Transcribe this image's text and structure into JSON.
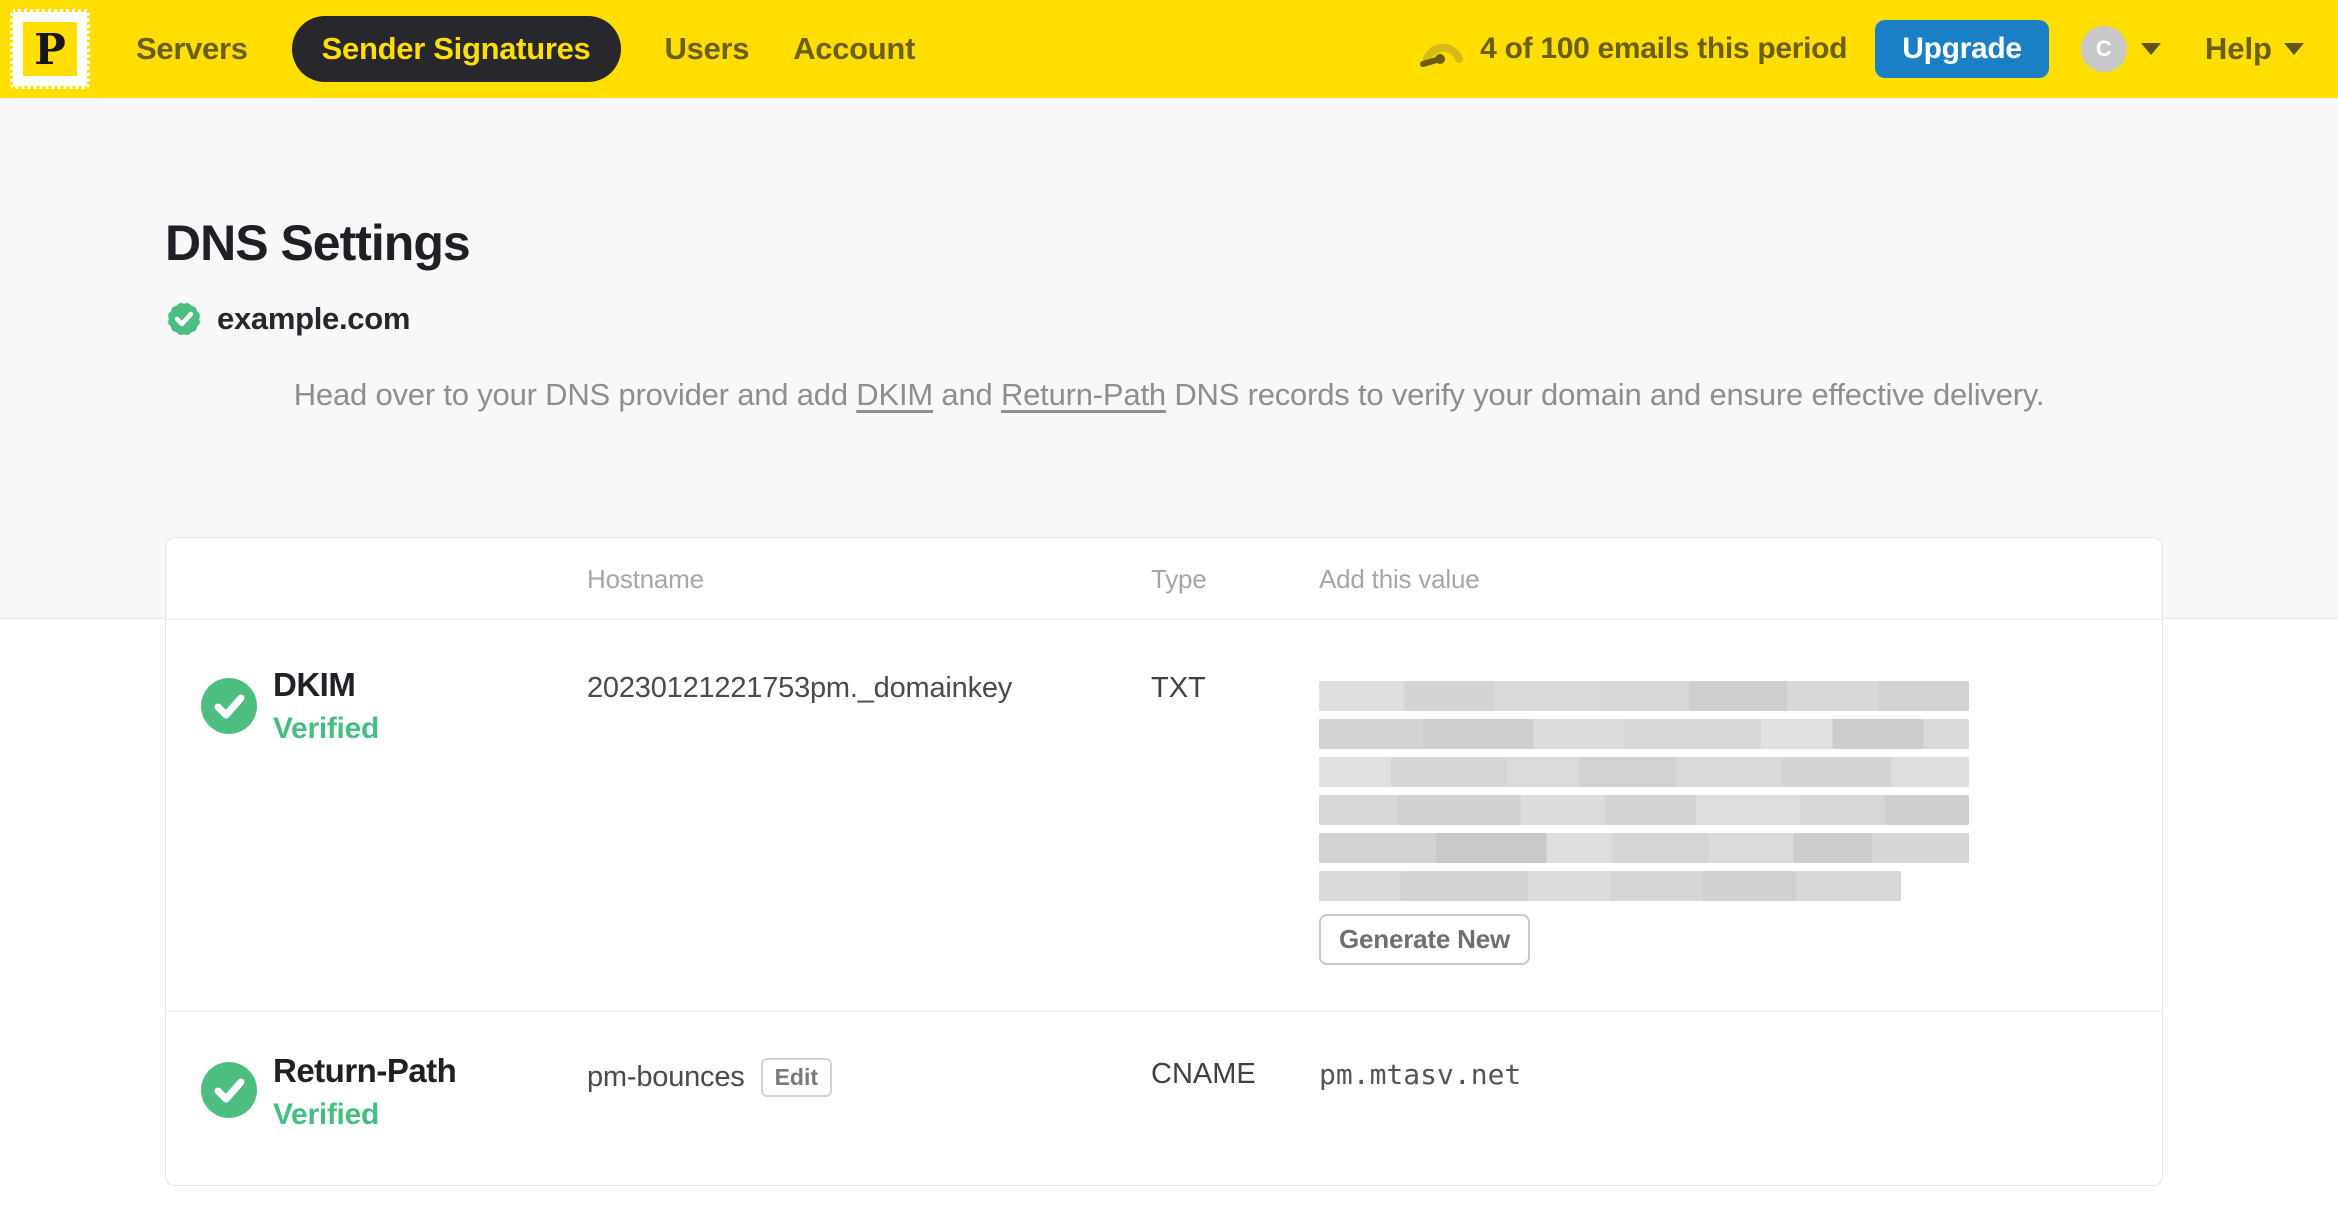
{
  "nav": {
    "logo_letter": "P",
    "items": [
      {
        "label": "Servers",
        "active": false
      },
      {
        "label": "Sender Signatures",
        "active": true
      },
      {
        "label": "Users",
        "active": false
      },
      {
        "label": "Account",
        "active": false
      }
    ],
    "usage_text": "4 of 100 emails this period",
    "upgrade_label": "Upgrade",
    "avatar_initial": "C",
    "help_label": "Help"
  },
  "page": {
    "title": "DNS Settings",
    "domain": "example.com",
    "description": {
      "part1": "Head over to your DNS provider and add ",
      "link_dkim": "DKIM",
      "part2": " and ",
      "link_return_path": "Return-Path",
      "part3": " DNS records to verify your domain and ensure effective delivery."
    }
  },
  "table": {
    "headers": {
      "hostname": "Hostname",
      "type": "Type",
      "value": "Add this value"
    },
    "rows": [
      {
        "name": "DKIM",
        "status": "Verified",
        "hostname": "20230121221753pm._domainkey",
        "type": "TXT",
        "value": "(redacted)",
        "action_label": "Generate New"
      },
      {
        "name": "Return-Path",
        "status": "Verified",
        "hostname": "pm-bounces",
        "edit_label": "Edit",
        "type": "CNAME",
        "value": "pm.mtasv.net"
      }
    ]
  },
  "colors": {
    "brand_yellow": "#FFDE00",
    "active_pill": "#28282C",
    "upgrade_blue": "#1B7FC6",
    "verified_green": "#4DBE82"
  }
}
